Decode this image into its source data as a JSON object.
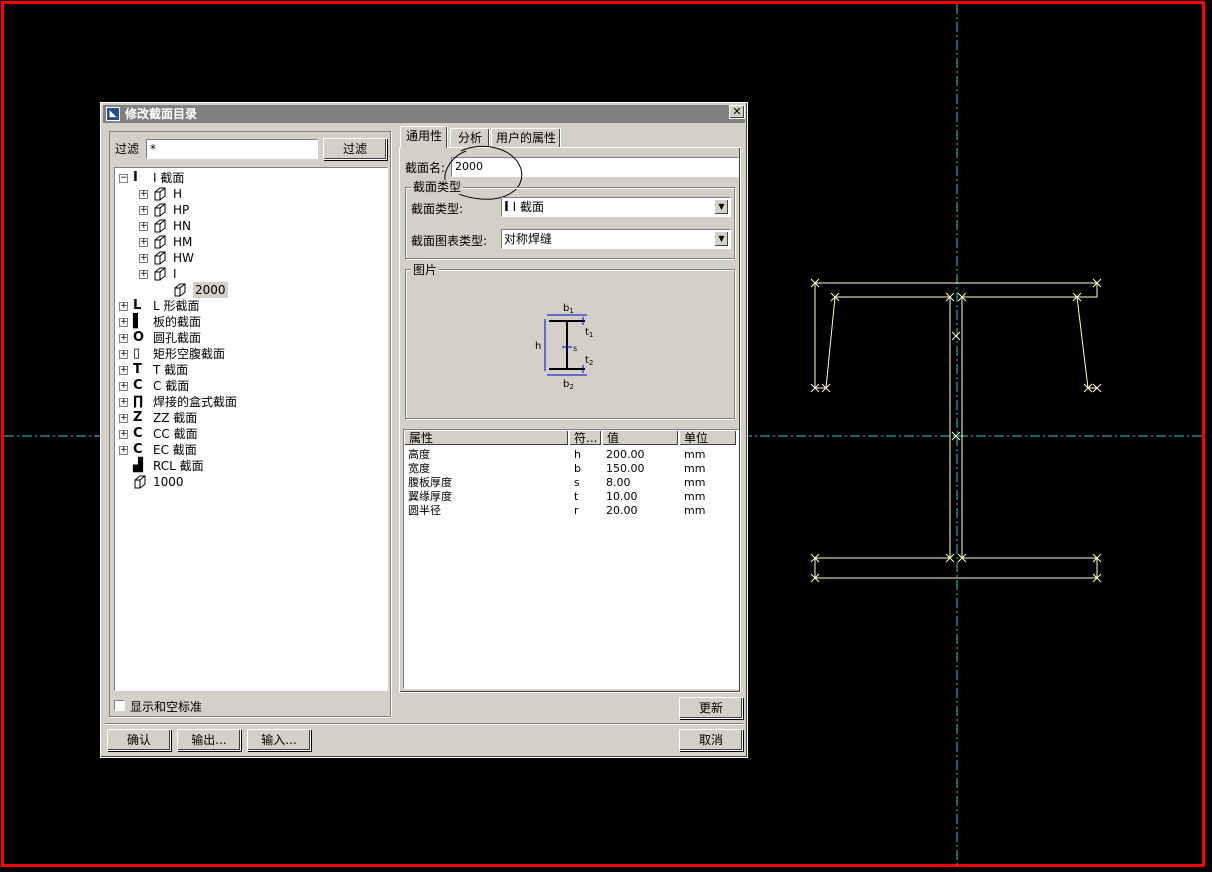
{
  "dialog": {
    "title": "修改截面目录",
    "close": "✕"
  },
  "filter": {
    "label": "过滤",
    "value": "*",
    "button": "过滤"
  },
  "tree": [
    {
      "label": "I 截面",
      "icon": "I",
      "expander": "−"
    },
    {
      "label": "H",
      "expander": "+"
    },
    {
      "label": "HP",
      "expander": "+"
    },
    {
      "label": "HN",
      "expander": "+"
    },
    {
      "label": "HM",
      "expander": "+"
    },
    {
      "label": "HW",
      "expander": "+"
    },
    {
      "label": "I",
      "expander": "+"
    },
    {
      "label": "2000"
    },
    {
      "label": "L 形截面",
      "icon": "L",
      "expander": "+"
    },
    {
      "label": "板的截面",
      "icon": "▌",
      "expander": "+"
    },
    {
      "label": "圆孔截面",
      "icon": "O",
      "expander": "+"
    },
    {
      "label": "矩形空腹截面",
      "icon": "▯",
      "expander": "+"
    },
    {
      "label": "T 截面",
      "icon": "T",
      "expander": "+"
    },
    {
      "label": "C 截面",
      "icon": "C",
      "expander": "+"
    },
    {
      "label": "焊接的盒式截面",
      "icon": "∏",
      "expander": "+"
    },
    {
      "label": "ZZ 截面",
      "icon": "Z",
      "expander": "+"
    },
    {
      "label": "CC 截面",
      "icon": "C",
      "expander": "+"
    },
    {
      "label": "EC 截面",
      "icon": "C",
      "expander": "+"
    },
    {
      "label": "RCL 截面",
      "icon": "▟"
    },
    {
      "label": "1000"
    }
  ],
  "show_checkbox": {
    "label": "显示和空标准"
  },
  "tabs": [
    "通用性",
    "分析",
    "用户的属性"
  ],
  "general": {
    "name_label": "截面名:",
    "name_value": "2000",
    "type_group": "截面类型",
    "type_label": "截面类型:",
    "type_value": "I 截面",
    "chart_label": "截面图表类型:",
    "chart_value": "对称焊缝",
    "picture_group": "图片",
    "picture_labels": {
      "b1": "b",
      "b1_sub": "1",
      "t1": "t",
      "t1_sub": "1",
      "h": "h",
      "s": "s",
      "t2": "t",
      "t2_sub": "2",
      "b2": "b",
      "b2_sub": "2"
    }
  },
  "props_table": {
    "headers": [
      "属性",
      "符...",
      "值",
      "单位"
    ],
    "rows": [
      {
        "name": "高度",
        "sym": "h",
        "value": "200.00",
        "unit": "mm"
      },
      {
        "name": "宽度",
        "sym": "b",
        "value": "150.00",
        "unit": "mm"
      },
      {
        "name": "腹板厚度",
        "sym": "s",
        "value": "8.00",
        "unit": "mm"
      },
      {
        "name": "翼缘厚度",
        "sym": "t",
        "value": "10.00",
        "unit": "mm"
      },
      {
        "name": "圆半径",
        "sym": "r",
        "value": "20.00",
        "unit": "mm"
      }
    ]
  },
  "buttons": {
    "update": "更新",
    "ok": "确认",
    "export": "输出...",
    "import": "输入...",
    "cancel": "取消"
  },
  "colors": {
    "canvas_bg": "#000000",
    "border_red": "#ff0000",
    "axis_cyan": "#33cccc",
    "shape_yellow": "#ffffcc",
    "dialog_bg": "#d4d0c8"
  }
}
